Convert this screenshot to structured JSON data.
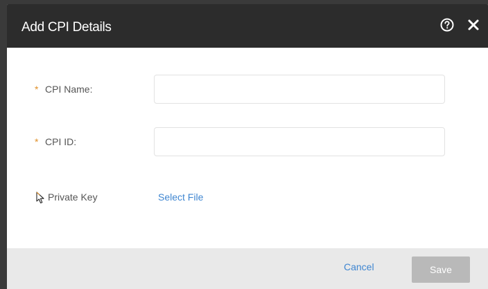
{
  "dialog": {
    "title": "Add CPI Details",
    "help_icon": "help-circle-icon",
    "close_icon": "close-icon"
  },
  "form": {
    "cpi_name": {
      "required_mark": "*",
      "label": "CPI Name:",
      "value": "",
      "placeholder": ""
    },
    "cpi_id": {
      "required_mark": "*",
      "label": "CPI ID:",
      "value": "",
      "placeholder": ""
    },
    "private_key": {
      "label": "Private Key",
      "link_label": "Select File"
    }
  },
  "footer": {
    "cancel_label": "Cancel",
    "save_label": "Save",
    "save_enabled": false
  },
  "colors": {
    "header_bg": "#2c2c2c",
    "required": "#e0902a",
    "link": "#3f86d1",
    "footer_bg": "#e9e9e9",
    "save_disabled_bg": "#b9b9b9"
  }
}
